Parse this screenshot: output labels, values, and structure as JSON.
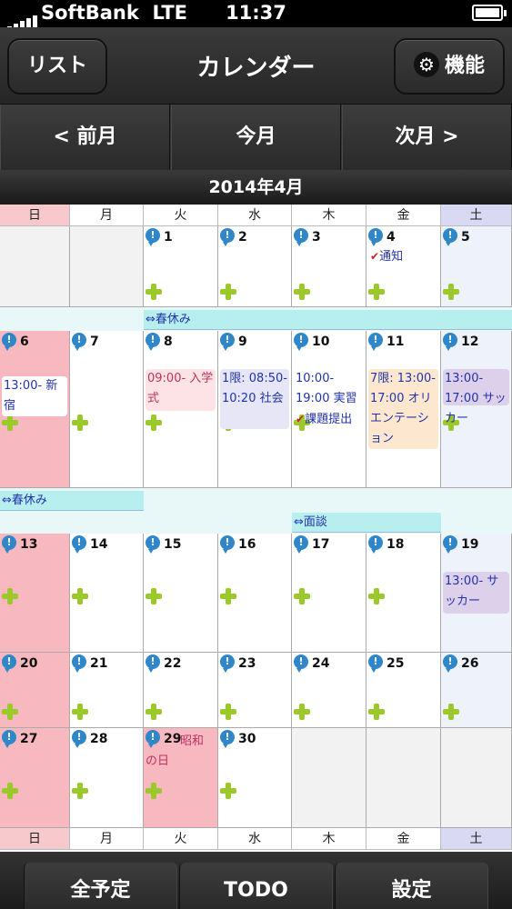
{
  "status": {
    "carrier": "SoftBank",
    "network": "LTE",
    "time": "11:37"
  },
  "nav": {
    "left_button": "リスト",
    "title": "カレンダー",
    "right_button": "機能"
  },
  "month_nav": {
    "prev": "< 前月",
    "today": "今月",
    "next": "次月 >"
  },
  "month_title": "2014年4月",
  "weekdays": [
    "日",
    "月",
    "火",
    "水",
    "木",
    "金",
    "土"
  ],
  "weeks": [
    {
      "days": [
        "",
        "",
        "1",
        "2",
        "3",
        "4",
        "5"
      ]
    },
    {
      "days": [
        "6",
        "7",
        "8",
        "9",
        "10",
        "11",
        "12"
      ]
    },
    {
      "days": [
        "13",
        "14",
        "15",
        "16",
        "17",
        "18",
        "19"
      ]
    },
    {
      "days": [
        "20",
        "21",
        "22",
        "23",
        "24",
        "25",
        "26"
      ]
    },
    {
      "days": [
        "27",
        "28",
        "29",
        "30",
        "",
        "",
        ""
      ]
    }
  ],
  "bars": {
    "spring_break_1": "⇔春休み",
    "spring_break_2": "⇔春休み",
    "interview": "⇔面談"
  },
  "events": {
    "d4": "通知",
    "d6": "13:00- 新宿",
    "d8": "09:00- 入学式",
    "d9": "1限: 08:50-10:20 社会",
    "d10_1": "10:00-19:00 実習",
    "d10_2": "課題提出",
    "d11": "7限: 13:00-17:00 オリエンテーション",
    "d12": "13:00-17:00 サッカー",
    "d19": "13:00- サッカー",
    "d29": "昭和の日"
  },
  "toolbar": {
    "all": "全予定",
    "todo": "TODO",
    "settings": "設定"
  },
  "colors": {
    "sunday": "#f7b8bf",
    "saturday": "#eef3fb",
    "holiday_bar": "#b7eeee",
    "plus": "#9bc92b",
    "bubble": "#2f86c9"
  }
}
